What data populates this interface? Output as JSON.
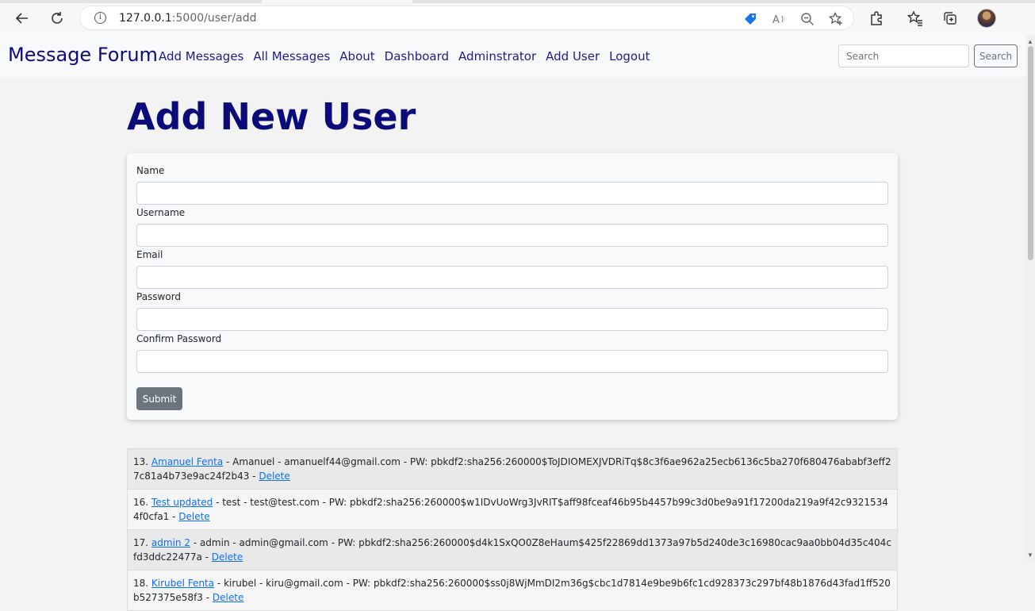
{
  "browser": {
    "url_host": "127.0.0.1",
    "url_path": ":5000/user/add"
  },
  "navbar": {
    "brand": "Message Forum",
    "links": [
      "Add Messages",
      "All Messages",
      "About",
      "Dashboard",
      "Adminstrator",
      "Add User",
      "Logout"
    ],
    "search_placeholder": "Search",
    "search_button": "Search"
  },
  "page": {
    "title": "Add New User"
  },
  "form": {
    "fields": [
      {
        "label": "Name",
        "value": ""
      },
      {
        "label": "Username",
        "value": ""
      },
      {
        "label": "Email",
        "value": ""
      },
      {
        "label": "Password",
        "value": ""
      },
      {
        "label": "Confirm Password",
        "value": ""
      }
    ],
    "submit_label": "Submit"
  },
  "users": [
    {
      "prefix": "13.",
      "name": "Amanuel Fenta",
      "details": " - Amanuel - amanuelf44@gmail.com - PW: pbkdf2:sha256:260000$ToJDIOMEXJVDRiTq$8c3f6ae962a25ecb6136c5ba270f680476ababf3eff27c81a4b73e9ac24f2b43 - ",
      "action": "Delete"
    },
    {
      "prefix": "16.",
      "name": "Test updated",
      "details": " - test - test@test.com - PW: pbkdf2:sha256:260000$w1IDvUoWrg3JvRIT$aff98fceaf46b95b4457b99c3d0be9a91f17200da219a9f42c93215344f0cfa1 - ",
      "action": "Delete"
    },
    {
      "prefix": "17.",
      "name": "admin 2",
      "details": " - admin - admin@gmail.com - PW: pbkdf2:sha256:260000$d4k1SxQO0Z8eHaum$425f22869dd1373a97b5d240de3c16980cac9aa0bb04d35c404cfd3ddc22477a - ",
      "action": "Delete"
    },
    {
      "prefix": "18.",
      "name": "Kirubel Fenta",
      "details": " - kirubel - kiru@gmail.com - PW: pbkdf2:sha256:260000$ss0j8WjMmDI2m36g$cbc1d7814e9be9b6fc1cd928373c297bf48b1876d43fad1ff520b527375e58f3 - ",
      "action": "Delete"
    }
  ]
}
